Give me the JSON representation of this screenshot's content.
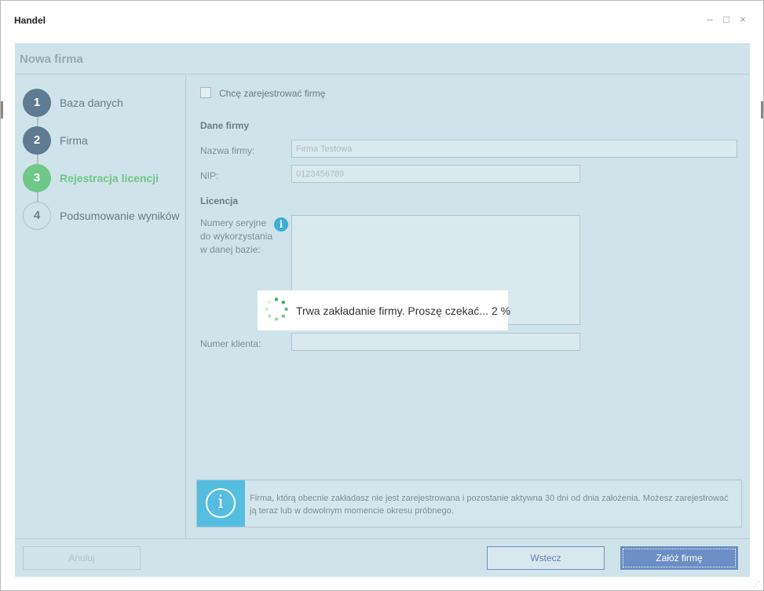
{
  "window": {
    "title": "Handel",
    "minimize_glyph": "–",
    "maximize_glyph": "□",
    "close_glyph": "×"
  },
  "dialog": {
    "title": "Nowa firma"
  },
  "steps": [
    {
      "number": "1",
      "label": "Baza danych",
      "state": "done"
    },
    {
      "number": "2",
      "label": "Firma",
      "state": "done"
    },
    {
      "number": "3",
      "label": "Rejestracja licencji",
      "state": "active"
    },
    {
      "number": "4",
      "label": "Podsumowanie wyników",
      "state": "todo"
    }
  ],
  "form": {
    "register_checkbox_label": "Chcę zarejestrować firmę",
    "register_checked": false,
    "company_section": "Dane firmy",
    "company_name_label": "Nazwa firmy:",
    "company_name_value": "Firma Testowa",
    "nip_label": "NIP:",
    "nip_value": "0123456789",
    "license_section": "Licencja",
    "serials_label": "Numery seryjne do wykorzystania w danej bazie:",
    "serials_value": "",
    "client_number_label": "Numer klienta:",
    "client_number_value": ""
  },
  "info": {
    "text": "Firma, którą obecnie zakładasz nie jest zarejestrowana i pozostanie aktywna 30 dni od dnia założenia. Możesz zarejestrować ją teraz lub w dowolnym momencie okresu próbnego."
  },
  "buttons": {
    "cancel": "Anuluj",
    "back": "Wstecz",
    "create": "Załóż firmę"
  },
  "loading": {
    "text": "Trwa zakładanie firmy. Proszę czekać... 2 %",
    "progress_percent": 2
  },
  "colors": {
    "accent_green": "#6fc788",
    "done_step": "#5e7b93",
    "info_blue": "#55bde0",
    "primary_button": "#6b8fc4",
    "dialog_bg": "#cfe3ea"
  },
  "icons": {
    "info": "info-icon",
    "spinner": "loading-spinner-icon",
    "resize": "resize-grip-icon"
  }
}
